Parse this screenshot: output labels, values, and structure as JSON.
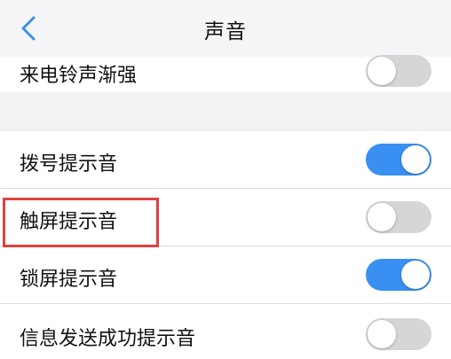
{
  "header": {
    "title": "声音",
    "back_icon": "chevron-left-icon",
    "accent_color": "#3a8ff2"
  },
  "settings": [
    {
      "label": "来电铃声渐强",
      "enabled": false
    },
    {
      "label": "拨号提示音",
      "enabled": true
    },
    {
      "label": "触屏提示音",
      "enabled": false,
      "highlighted": true
    },
    {
      "label": "锁屏提示音",
      "enabled": true
    },
    {
      "label": "信息发送成功提示音",
      "enabled": false
    }
  ],
  "highlight_color": "#e0403f"
}
